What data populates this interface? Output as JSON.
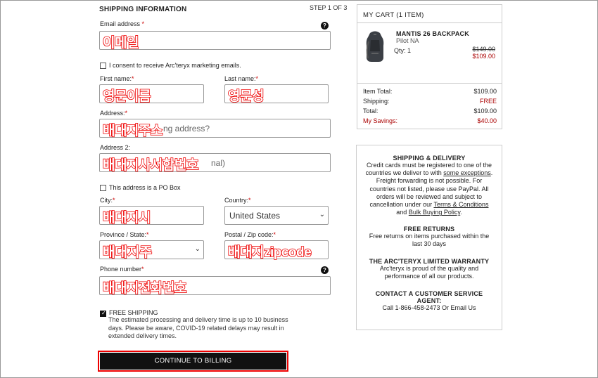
{
  "form": {
    "section_title": "SHIPPING INFORMATION",
    "step": "STEP 1 OF 3",
    "required_mark": "*",
    "email": {
      "label": "Email address",
      "overlay": "이메일"
    },
    "consent": "I consent to receive Arc'teryx marketing emails.",
    "first_name": {
      "label": "First name:",
      "overlay": "영문이름"
    },
    "last_name": {
      "label": "Last name:",
      "overlay": "영문성"
    },
    "address": {
      "label": "Address:",
      "placeholder": "ng address?",
      "overlay": "배대지주소"
    },
    "address2": {
      "label": "Address 2:",
      "placeholder": "nal)",
      "overlay": "배대지사서함번호"
    },
    "po_box": "This address is a PO Box",
    "city": {
      "label": "City:",
      "overlay": "배대지시"
    },
    "country": {
      "label": "Country:",
      "value": "United States"
    },
    "province": {
      "label": "Province / State:",
      "overlay": "배대지주"
    },
    "zip": {
      "label": "Postal / Zip code:",
      "overlay": "배대지zipcode"
    },
    "phone": {
      "label": "Phone number",
      "overlay": "배대지전화번호"
    },
    "free_shipping": {
      "title": "FREE SHIPPING",
      "desc": "The estimated processing and delivery time is up to 10 business days. Please be aware, COVID-19 related delays may result in extended delivery times."
    },
    "continue": "CONTINUE TO BILLING",
    "help_glyph": "?"
  },
  "cart": {
    "title": "MY CART (1 ITEM)",
    "product": "MANTIS 26 BACKPACK",
    "color": "Pilot NA",
    "qty": "Qty: 1",
    "price_old": "$149.00",
    "price_new": "$109.00",
    "item_total_label": "Item Total:",
    "item_total": "$109.00",
    "shipping_label": "Shipping:",
    "shipping": "FREE",
    "total_label": "Total:",
    "total": "$109.00",
    "savings_label": "My Savings:",
    "savings": "$40.00"
  },
  "info": {
    "ship_title": "SHIPPING & DELIVERY",
    "ship_text_1": "Credit cards must be registered to one of the countries we deliver to with",
    "ship_link_1": "some exceptions",
    "ship_text_2": ". Freight forwarding is not possible. For countries not listed, please use PayPal. All orders will be reviewed and subject to cancellation under our",
    "ship_link_2": "Terms & Conditions",
    "ship_text_3": "and",
    "ship_link_3": "Bulk Buying Policy",
    "ship_text_4": ".",
    "returns_title": "FREE RETURNS",
    "returns_text": "Free returns on items purchased within the last 30 days",
    "warranty_title": "THE ARC'TERYX LIMITED WARRANTY",
    "warranty_text": "Arc'teryx is proud of the quality and performance of all our products.",
    "contact_title": "CONTACT A CUSTOMER SERVICE AGENT:",
    "contact_text": "Call 1-866-458-2473 Or Email Us"
  },
  "colors": {
    "accent_red": "#e00000",
    "button_bg": "#111111",
    "sale_red": "#aa0000"
  }
}
